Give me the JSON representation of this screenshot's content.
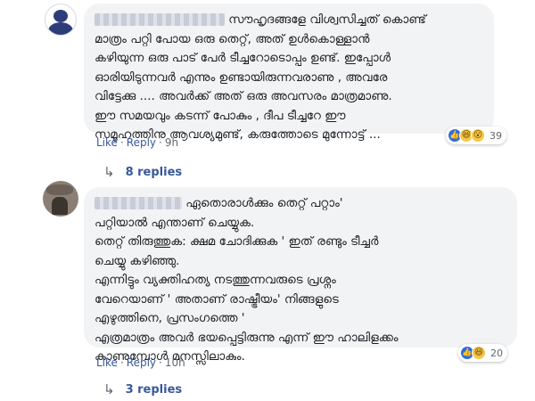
{
  "comments": [
    {
      "author": "▒▒▒▒▒▒▒▒▒▒▒▒",
      "first_line": "സൗഹൃദങ്ങളേ വിശ്വസിച്ചത് കൊണ്ട്",
      "body": "മാത്രം പറ്റി പോയ ഒരു തെറ്റ്, അത് ഉൾകൊള്ളാൻ\nകഴിയുന്ന ഒരു പാട് പേർ ടീച്ചറോടൊപ്പം ഉണ്ട്. ഇപ്പോൾ\nഓരിയിടുന്നവർ എന്നും ഉണ്ടായിരുന്നവരാണു , അവരേ\nവിട്ടേക്കു .... അവർക്ക് അത് ഒരു അവസരം മാത്രമാണു.\nഈ സമയവും കടന്ന് പോകും , ദീപ ടീച്ചറേ ഈ\nസമൂഹത്തിനു ആവശ്യമുണ്ട്, കരുത്തോടെ മുന്നോട്ട് ...",
      "like_label": "Like",
      "reply_label": "Reply",
      "time": "9h",
      "reaction_count": "39",
      "replies_label": "8 replies"
    },
    {
      "author": "▒▒▒▒▒▒▒▒",
      "first_line": "ഏതൊരാൾക്കും തെറ്റ് പറ്റാം'",
      "body": "പറ്റിയാൽ എന്താണ് ചെയ്യുക.\nതെറ്റ് തിരുത്തുക: ക്ഷമ ചോദിക്കുക ' ഇത് രണ്ടും ടീച്ചർ\nചെയ്യു കഴിഞ്ഞു.\nഎന്നിട്ടും വ്യക്തിഹത്യ നടത്തുന്നവരുടെ പ്രശ്നം\nവേറെയാണ് ' അതാണ് രാഷ്ട്രീയം' നിങ്ങളുടെ\nഎഴുത്തിനെ, പ്രസംഗത്തെ '\nഎത്രമാത്രം അവർ ഭയപ്പെട്ടിരുന്നു എന്ന് ഈ ഹാലിളക്കം\nകാണുമ്പോൾ മനസ്സിലാകും.",
      "like_label": "Like",
      "reply_label": "Reply",
      "time": "10h",
      "reaction_count": "20",
      "replies_label": "3 replies"
    }
  ],
  "icons": {
    "like": "like-icon",
    "haha": "haha-icon",
    "wow": "wow-icon",
    "reply_arrow": "reply-arrow-icon"
  },
  "colors": {
    "link": "#385898",
    "bubble": "#f2f3f5",
    "like_blue": "#2e6ddf"
  }
}
